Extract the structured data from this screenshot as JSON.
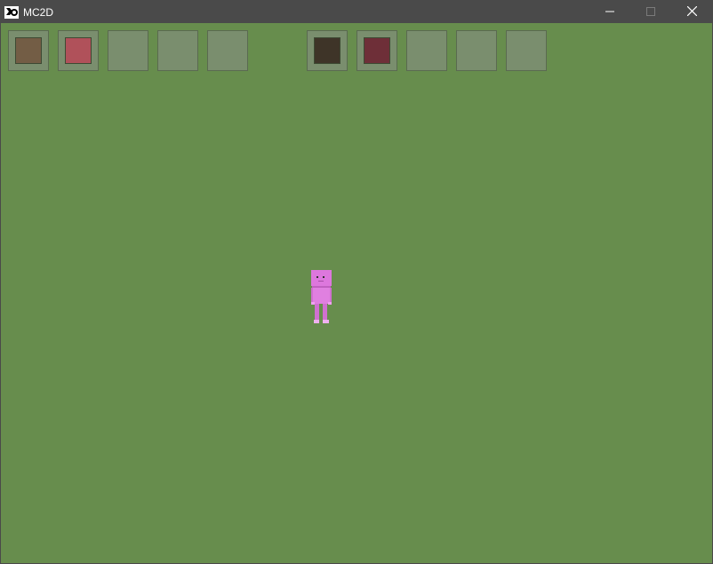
{
  "window": {
    "title": "MC2D",
    "app_icon": "mc2d-logo-icon",
    "controls": [
      "minimize-icon",
      "maximize-icon",
      "close-icon"
    ]
  },
  "colors": {
    "grass": "#678d4d",
    "slot_bg": "#7a8e6e",
    "player": "#dd77dd"
  },
  "hotbar_left": {
    "slots": [
      {
        "item_color": "#735d45"
      },
      {
        "item_color": "#b0515a"
      },
      {
        "item_color": null
      },
      {
        "item_color": null
      },
      {
        "item_color": null
      }
    ]
  },
  "hotbar_right": {
    "slots": [
      {
        "item_color": "#3e3428"
      },
      {
        "item_color": "#6e2f38"
      },
      {
        "item_color": null
      },
      {
        "item_color": null
      },
      {
        "item_color": null
      }
    ]
  }
}
